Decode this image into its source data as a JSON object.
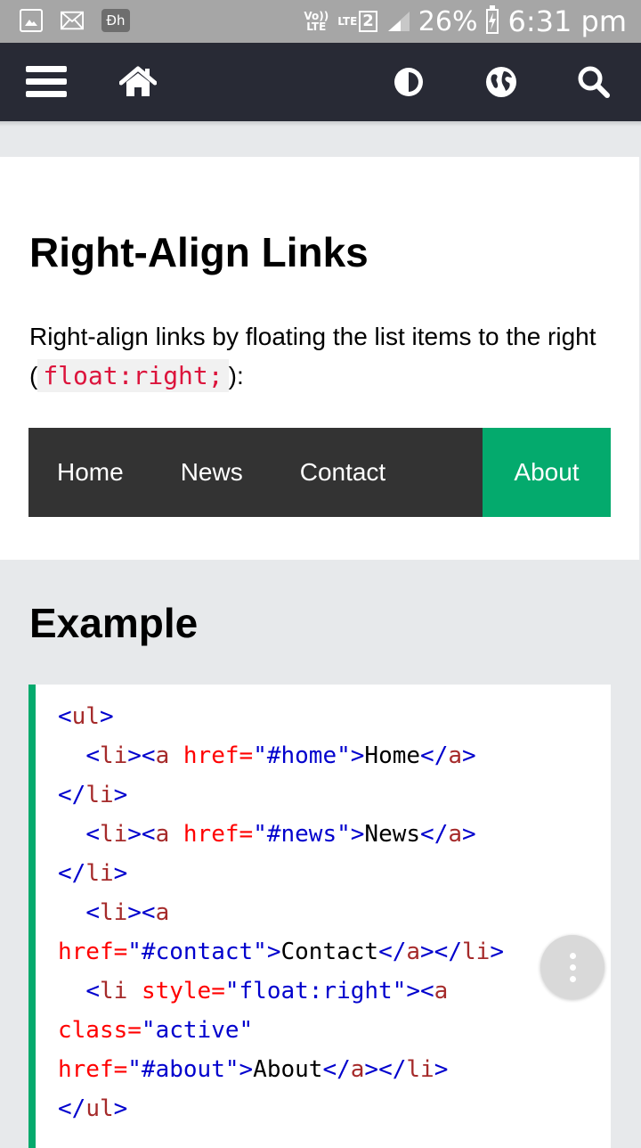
{
  "status_bar": {
    "left_icons": [
      "gallery-icon",
      "mail-icon",
      "app-icon"
    ],
    "app_icon_text": "Ɖh",
    "volte": "Vo))",
    "volte_sub": "LTE",
    "lte": "LTE",
    "sim": "2",
    "battery": "26%",
    "time": "6:31 pm"
  },
  "topnav": {
    "icons": [
      "menu-icon",
      "home-icon",
      "contrast-icon",
      "globe-icon",
      "search-icon"
    ]
  },
  "section": {
    "title": "Right-Align Links",
    "intro_before": "Right-align links by floating the list items to the right (",
    "intro_code": "float:right;",
    "intro_after": "):"
  },
  "demo_nav": {
    "links": [
      "Home",
      "News",
      "Contact"
    ],
    "active_link": "About",
    "colors": {
      "bar": "#333333",
      "active": "#04AA6D"
    }
  },
  "example": {
    "title": "Example",
    "code": {
      "ul_open": "ul",
      "home_href": "\"#home\"",
      "home_text": "Home",
      "news_href": "\"#news\"",
      "news_text": "News",
      "contact_href": "\"#contact\"",
      "contact_text": "Contact",
      "style_val": "\"float:right\"",
      "class_val": "\"active\"",
      "about_href": "\"#about\"",
      "about_text": "About"
    }
  }
}
